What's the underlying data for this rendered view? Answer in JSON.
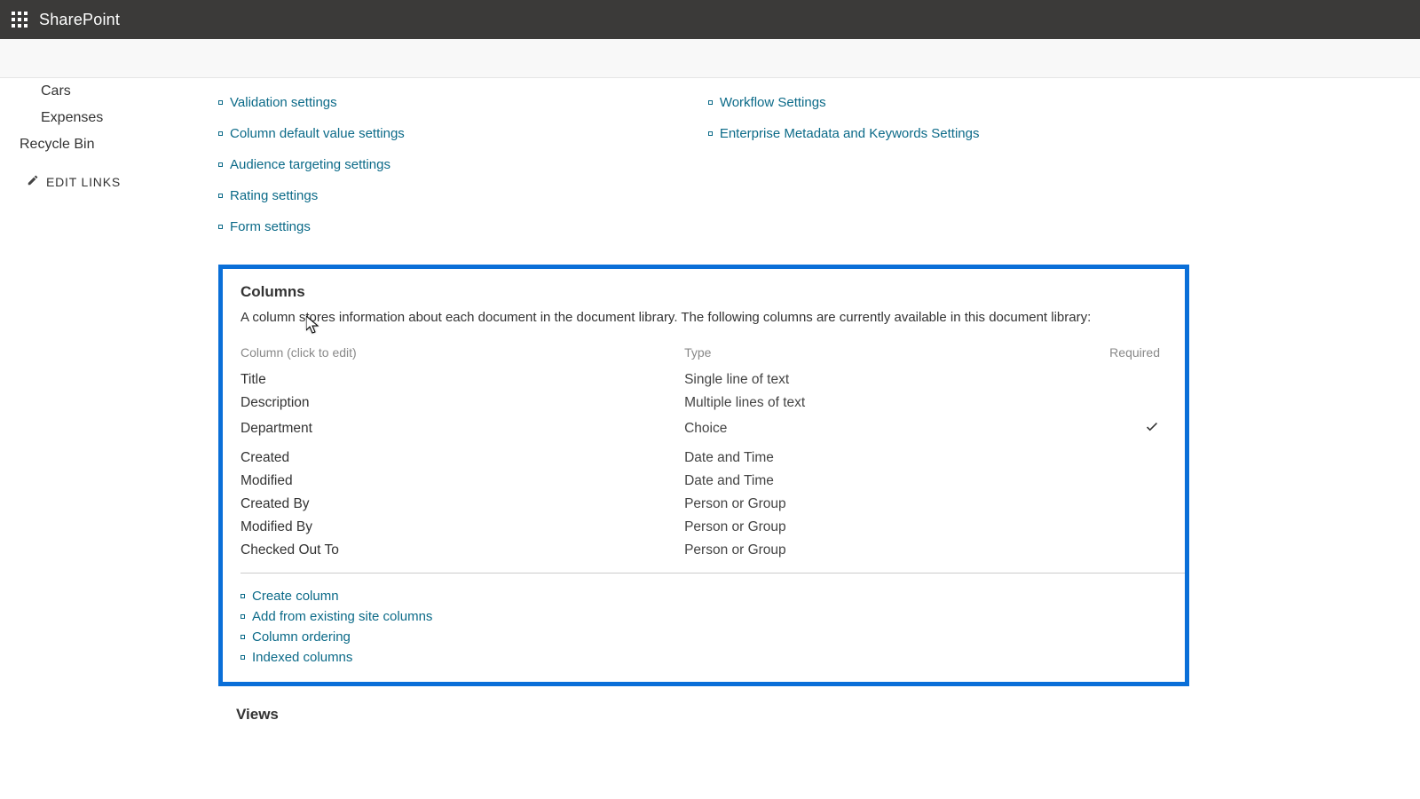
{
  "header": {
    "brand": "SharePoint"
  },
  "sidenav": {
    "items": [
      {
        "label": "Cars",
        "indent": true
      },
      {
        "label": "Expenses",
        "indent": true
      },
      {
        "label": "Recycle Bin",
        "indent": false
      }
    ],
    "edit": "EDIT LINKS"
  },
  "general_settings": {
    "left": [
      "Validation settings",
      "Column default value settings",
      "Audience targeting settings",
      "Rating settings",
      "Form settings"
    ],
    "right": [
      "Workflow Settings",
      "Enterprise Metadata and Keywords Settings"
    ]
  },
  "columns": {
    "title": "Columns",
    "desc": "A column stores information about each document in the document library. The following columns are currently available in this document library:",
    "headers": {
      "name": "Column (click to edit)",
      "type": "Type",
      "required": "Required"
    },
    "rows": [
      {
        "name": "Title",
        "type": "Single line of text",
        "required": false
      },
      {
        "name": "Description",
        "type": "Multiple lines of text",
        "required": false
      },
      {
        "name": "Department",
        "type": "Choice",
        "required": true
      },
      {
        "name": "Created",
        "type": "Date and Time",
        "required": false
      },
      {
        "name": "Modified",
        "type": "Date and Time",
        "required": false
      },
      {
        "name": "Created By",
        "type": "Person or Group",
        "required": false
      },
      {
        "name": "Modified By",
        "type": "Person or Group",
        "required": false
      },
      {
        "name": "Checked Out To",
        "type": "Person or Group",
        "required": false
      }
    ],
    "actions": [
      "Create column",
      "Add from existing site columns",
      "Column ordering",
      "Indexed columns"
    ]
  },
  "views": {
    "title": "Views"
  }
}
